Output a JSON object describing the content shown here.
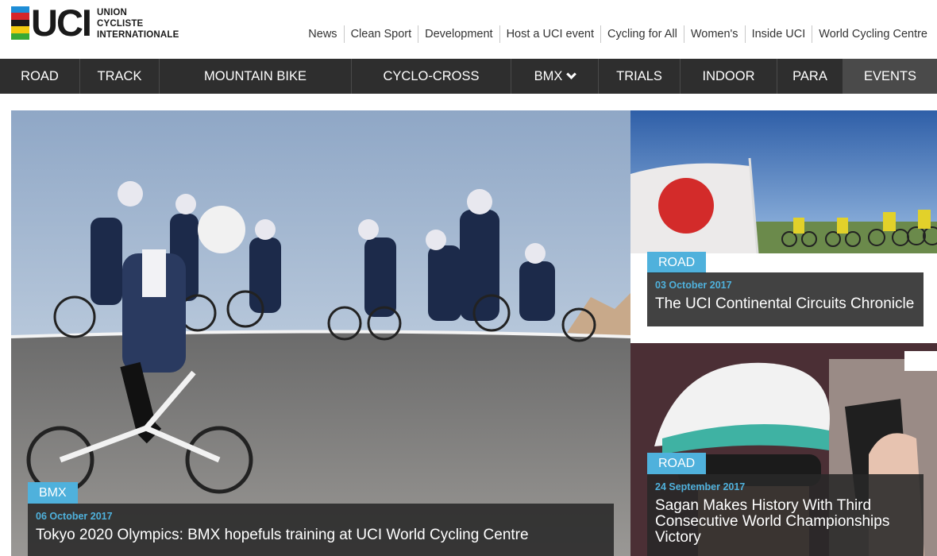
{
  "logo": {
    "mark": "UCI",
    "lines": [
      "UNION",
      "CYCLISTE",
      "INTERNATIONALE"
    ],
    "stripe_colors": [
      "#1e8dd6",
      "#d6262a",
      "#1a1a1a",
      "#f2cb10",
      "#39a935"
    ]
  },
  "topnav": {
    "items": [
      "News",
      "Clean Sport",
      "Development",
      "Host a UCI event",
      "Cycling for All",
      "Women's",
      "Inside UCI",
      "World Cycling Centre"
    ]
  },
  "mainnav": {
    "items": [
      {
        "label": "ROAD"
      },
      {
        "label": "TRACK"
      },
      {
        "label": "MOUNTAIN BIKE"
      },
      {
        "label": "CYCLO-CROSS"
      },
      {
        "label": "BMX"
      },
      {
        "label": "TRIALS"
      },
      {
        "label": "INDOOR"
      },
      {
        "label": "PARA"
      },
      {
        "label": "EVENTS"
      }
    ]
  },
  "articles": [
    {
      "tag": "BMX",
      "date": "06 October 2017",
      "title": "Tokyo 2020 Olympics: BMX hopefuls training at UCI World Cycling Centre"
    },
    {
      "tag": "ROAD",
      "date": "03 October 2017",
      "title": "The UCI Continental Circuits Chronicle"
    },
    {
      "tag": "ROAD",
      "date": "24 September 2017",
      "title": "Sagan Makes History With Third Consecutive World Championships Victory"
    }
  ],
  "colors": {
    "accent": "#4fb1dc",
    "nav_bg": "#2e2e2e"
  }
}
